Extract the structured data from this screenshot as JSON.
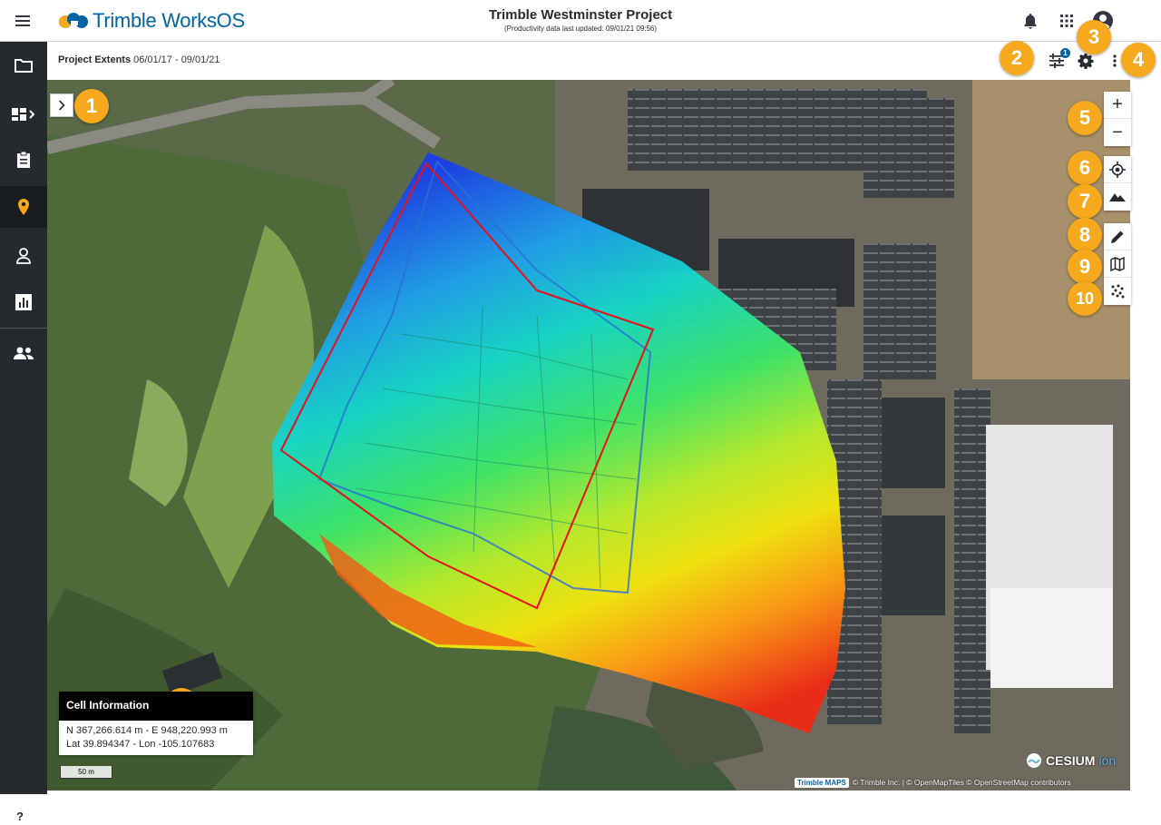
{
  "app": {
    "logo_text": "Trimble WorksOS",
    "project_title": "Trimble Westminster Project",
    "project_subtitle": "(Productivity data last updated: 09/01/21 09:56)"
  },
  "topbar_icons": [
    "menu-icon",
    "bell-icon",
    "apps-grid-icon",
    "account-icon"
  ],
  "sidebar": {
    "items": [
      {
        "icon": "folder-icon"
      },
      {
        "icon": "dashboard-icon"
      },
      {
        "icon": "clipboard-icon"
      },
      {
        "icon": "map-pin-icon",
        "active": true
      },
      {
        "icon": "person-icon"
      },
      {
        "icon": "report-chart-icon"
      },
      {
        "icon": "team-icon"
      }
    ],
    "help_label": "?"
  },
  "subheader": {
    "label": "Project Extents",
    "dates": "06/01/17 - 09/01/21",
    "filter_badge": "1"
  },
  "map_controls": {
    "zoom_in": "+",
    "zoom_out": "−",
    "tools": [
      "locate-icon",
      "terrain-icon",
      "pencil-icon",
      "map-layers-icon",
      "points-scatter-icon"
    ]
  },
  "callouts": [
    "1",
    "2",
    "3",
    "4",
    "5",
    "6",
    "7",
    "8",
    "9",
    "10",
    "11"
  ],
  "cell_info": {
    "title": "Cell Information",
    "coords": "N 367,266.614 m - E 948,220.993 m",
    "latlon": "Lat 39.894347 - Lon -105.107683"
  },
  "scale_label": "50 m",
  "attribution": {
    "badge": "Trimble MAPS",
    "text": "© Trimble Inc. | © OpenMapTiles © OpenStreetMap contributors"
  },
  "cesium": {
    "name": "CESIUM",
    "suffix": "ion"
  },
  "colors": {
    "accent": "#0063a3",
    "callout": "#f6a91c",
    "sidebar": "#252a2e",
    "active_pin": "#f6a91c",
    "boundary": "#e8101a"
  }
}
